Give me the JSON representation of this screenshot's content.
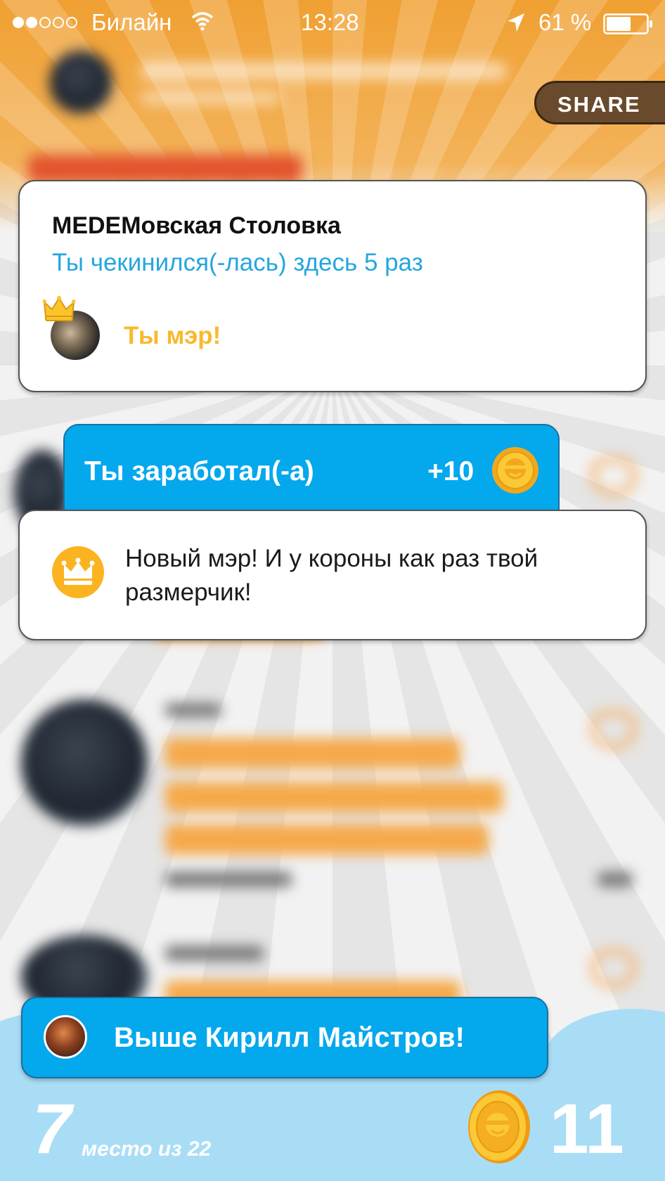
{
  "status_bar": {
    "carrier": "Билайн",
    "time": "13:28",
    "battery_percent": "61 %",
    "signal_bars_filled": 2,
    "signal_bars_total": 5,
    "battery_level": 0.61
  },
  "header": {
    "share_label": "SHARE"
  },
  "venue_card": {
    "name": "MEDEMовская Столовка",
    "checkins": "Ты чекинился(-лась) здесь 5 раз",
    "mayor_text": "Ты мэр!"
  },
  "earned": {
    "label": "Ты заработал(-а)",
    "points": "+10"
  },
  "notification": {
    "text": "Новый мэр! И у короны как раз твой размерчик!"
  },
  "leaderboard": {
    "above_text": "Выше Кирилл Майстров!",
    "rank": "7",
    "rank_suffix": "место из 22",
    "coins": "11"
  },
  "colors": {
    "accent_blue": "#04a8ec",
    "checkin_blue": "#24a6df",
    "mayor_gold": "#f9b92c",
    "header_orange": "#f0a032",
    "bottom_sky": "#a9ddf6"
  }
}
